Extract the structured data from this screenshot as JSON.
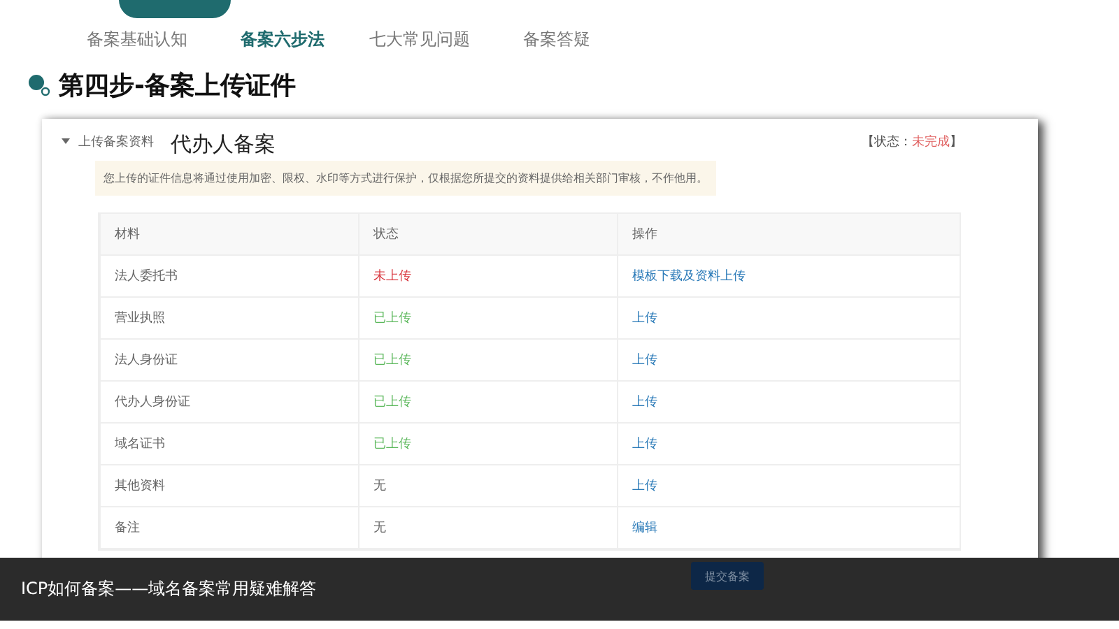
{
  "nav_tabs": [
    {
      "label": "备案基础认知",
      "selected": false
    },
    {
      "label": "备案六步法",
      "selected": true
    },
    {
      "label": "七大常见问题",
      "selected": false
    },
    {
      "label": "备案答疑",
      "selected": false
    }
  ],
  "heading": "第四步-备案上传证件",
  "screenshot": {
    "section_toggle": "上传备案资料",
    "expanded": true,
    "overlay_title": "代办人备案",
    "status_label": "【状态：",
    "status_value": "未完成",
    "status_end": "】",
    "notice": "您上传的证件信息将通过使用加密、限权、水印等方式进行保护，仅根据您所提交的资料提供给相关部门审核，不作他用。",
    "table": {
      "columns": [
        "材料",
        "状态",
        "操作"
      ],
      "rows": [
        {
          "material": "法人委托书",
          "status": "未上传",
          "kind": "missing",
          "action": "模板下载及资料上传"
        },
        {
          "material": "营业执照",
          "status": "已上传",
          "kind": "uploaded",
          "action": "上传"
        },
        {
          "material": "法人身份证",
          "status": "已上传",
          "kind": "uploaded",
          "action": "上传"
        },
        {
          "material": "代办人身份证",
          "status": "已上传",
          "kind": "uploaded",
          "action": "上传"
        },
        {
          "material": "域名证书",
          "status": "已上传",
          "kind": "uploaded",
          "action": "上传"
        },
        {
          "material": "其他资料",
          "status": "无",
          "kind": "none",
          "action": "上传"
        },
        {
          "material": "备注",
          "status": "无",
          "kind": "none",
          "action": "编辑"
        }
      ]
    },
    "submit_button": "提交备案"
  },
  "caption": "ICP如何备案——域名备案常用疑难解答"
}
